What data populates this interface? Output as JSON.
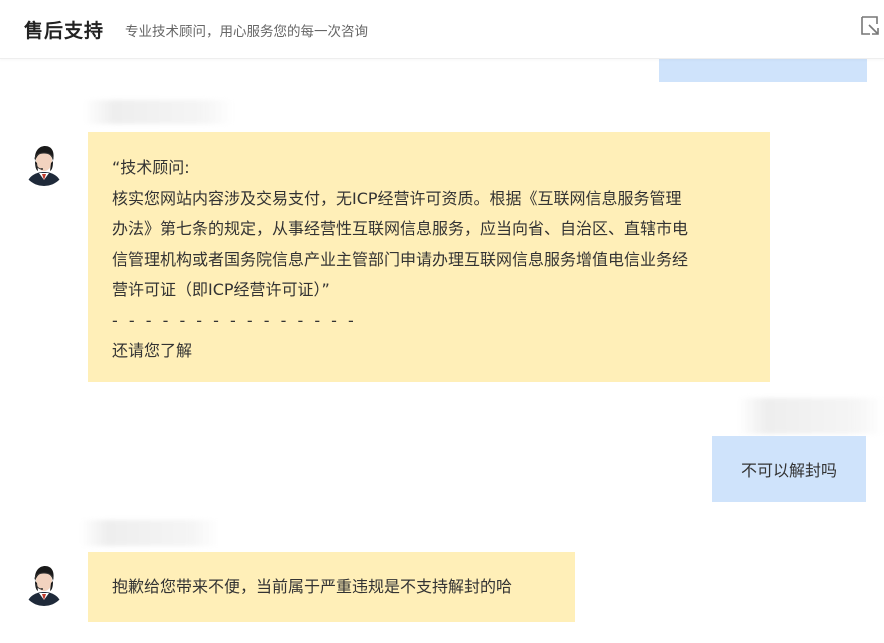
{
  "header": {
    "title": "售后支持",
    "subtitle": "专业技术顾问，用心服务您的每一次咨询",
    "icon": "minimize-icon"
  },
  "messages": [
    {
      "sender": "agent",
      "lines": [
        "“技术顾问:",
        "核实您网站内容涉及交易支付，无ICP经营许可资质。根据《互联网信息服务管理",
        "办法》第七条的规定，从事经营性互联网信息服务，应当向省、自治区、直辖市电",
        "信管理机构或者国务院信息产业主管部门申请办理互联网信息服务增值电信业务经",
        "营许可证（即ICP经营许可证）”"
      ],
      "separator": "- - - - - - - - - - - - - - -",
      "closing": "还请您了解"
    },
    {
      "sender": "user",
      "text": "不可以解封吗"
    },
    {
      "sender": "agent",
      "text": "抱歉给您带来不便，当前属于严重违规是不支持解封的哈"
    }
  ],
  "colors": {
    "agent_bubble": "#ffefb8",
    "user_bubble": "#cfe3fb",
    "header_text": "#222222"
  }
}
